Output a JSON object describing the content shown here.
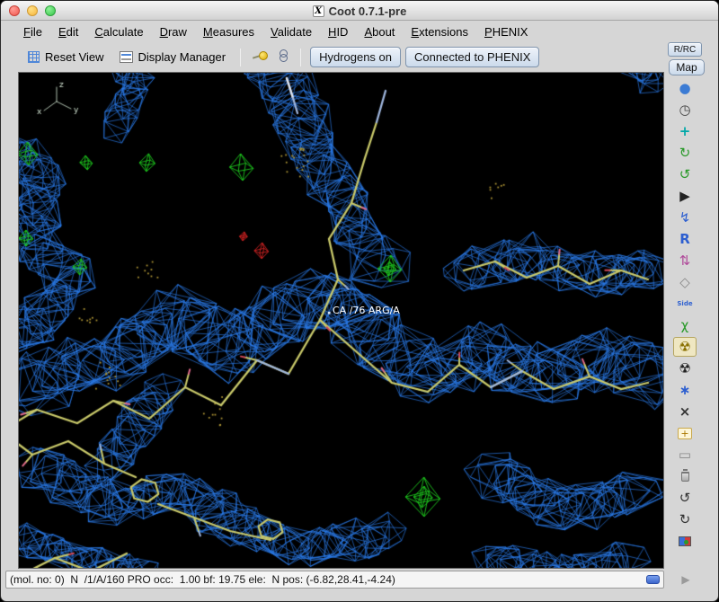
{
  "window": {
    "title": "Coot 0.7.1-pre",
    "app_icon": "X"
  },
  "menu": {
    "items": [
      {
        "label": "File"
      },
      {
        "label": "Edit"
      },
      {
        "label": "Calculate"
      },
      {
        "label": "Draw"
      },
      {
        "label": "Measures"
      },
      {
        "label": "Validate"
      },
      {
        "label": "HID"
      },
      {
        "label": "About"
      },
      {
        "label": "Extensions"
      },
      {
        "label": "PHENIX"
      }
    ]
  },
  "toolbar": {
    "reset_view_label": "Reset View",
    "display_manager_label": "Display Manager",
    "hydrogens_button": "Hydrogens on",
    "phenix_button": "Connected to PHENIX"
  },
  "right_panel": {
    "rrc_button": "R/RC",
    "map_button": "Map",
    "corner_glyph": "▶",
    "icons": [
      {
        "name": "views-sphere",
        "glyph": "●",
        "color": "#3b7bd4"
      },
      {
        "name": "recentre-clock",
        "glyph": "◷",
        "color": "#444444"
      },
      {
        "name": "move-molecule",
        "glyph": "+",
        "color": "#00a8a8",
        "bold": true
      },
      {
        "name": "rotate-translate",
        "glyph": "↻",
        "color": "#2a9a2a"
      },
      {
        "name": "torsion-general",
        "glyph": "↺",
        "color": "#2a9a2a"
      },
      {
        "name": "run-script",
        "glyph": "▶",
        "color": "#222222"
      },
      {
        "name": "real-space-refine",
        "glyph": "↯",
        "color": "#2d5fd0"
      },
      {
        "name": "auto-fit-rotamer",
        "glyph": "R",
        "color": "#2d5fd0",
        "bold": true
      },
      {
        "name": "pep-flip",
        "glyph": "⇅",
        "color": "#b04a9a"
      },
      {
        "name": "regularize-zone",
        "glyph": "◇",
        "color": "#888888"
      },
      {
        "name": "side-chain-flip",
        "glyph": "Side",
        "color": "#2d5fd0",
        "small": true
      },
      {
        "name": "edit-chi-angles",
        "glyph": "χ",
        "color": "#2a9a2a"
      },
      {
        "name": "model-fit-refine",
        "glyph": "☢",
        "color": "#8a7000",
        "active": true
      },
      {
        "name": "refine-residue",
        "glyph": "☢",
        "color": "#222222"
      },
      {
        "name": "add-alt-conf",
        "glyph": "∗",
        "color": "#2d5fd0",
        "bold": true
      },
      {
        "name": "mutate-residue",
        "glyph": "×",
        "color": "#333333",
        "bold": true
      },
      {
        "name": "add-terminal-residue",
        "glyph": "+",
        "color": "#aa7700",
        "boxed": true
      },
      {
        "name": "delete-item",
        "glyph": "▭",
        "color": "#888888"
      },
      {
        "name": "trash",
        "shape": "trash"
      },
      {
        "name": "undo",
        "glyph": "↺",
        "color": "#333333"
      },
      {
        "name": "redo",
        "glyph": "↻",
        "color": "#333333"
      },
      {
        "name": "display-manager-mini",
        "shape": "flag"
      }
    ]
  },
  "viewport": {
    "atom_label": "CA /76 ARG/A",
    "axes": {
      "x": "x",
      "y": "y",
      "z": "z"
    },
    "colors": {
      "background": "#000000",
      "density_map": "#2a7ae8",
      "difference_positive": "#1ecc1e",
      "difference_negative": "#d42222",
      "model_carbon": "#c9c96a",
      "model_nitrogen": "#9fb6de",
      "model_oxygen": "#d04a5a",
      "model_hydrogen_tick": "#e06a8a",
      "waters_dots": "#ad9434",
      "label": "#ffffff"
    }
  },
  "statusbar": {
    "text": "(mol. no: 0)  N  /1/A/160 PRO occ:  1.00 bf: 19.75 ele:  N pos: (-6.82,28.41,-4.24)"
  }
}
